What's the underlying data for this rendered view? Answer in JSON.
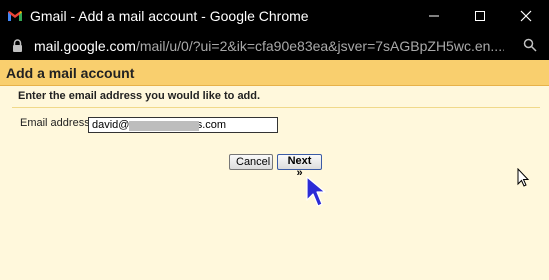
{
  "window": {
    "title": "Gmail - Add a mail account - Google Chrome"
  },
  "address_bar": {
    "domain": "mail.google.com",
    "path": "/mail/u/0/?ui=2&ik=cfa90e83ea&jsver=7sAGBpZH5wc.en...."
  },
  "dialog": {
    "title": "Add a mail account",
    "instruction": "Enter the email address you would like to add.",
    "email_label": "Email address:",
    "email_value": "david@                    ns.com",
    "cancel_label": "Cancel",
    "next_label": "Next »"
  },
  "colors": {
    "header_bg": "#f9cf6e",
    "body_bg": "#fff8dc",
    "cursor_blue": "#2b2bd6"
  },
  "icons": [
    "gmail-logo",
    "minimize-icon",
    "maximize-icon",
    "close-icon",
    "lock-icon",
    "zoom-icon",
    "pointer-cursor-icon",
    "arrow-cursor-icon"
  ]
}
